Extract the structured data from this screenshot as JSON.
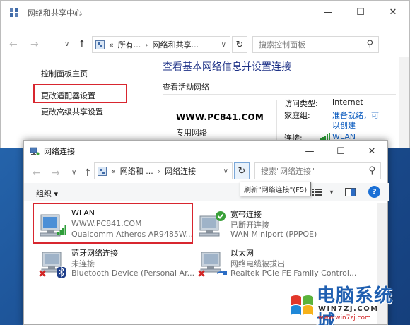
{
  "back_window": {
    "title": "网络和共享中心",
    "controls": {
      "minimize": "—",
      "maximize": "☐",
      "close": "✕"
    },
    "nav": {
      "back": "←",
      "forward": "→",
      "recent": "∨",
      "up": "↑"
    },
    "address": {
      "chevron": "«",
      "crumbs": [
        "所有...",
        "网络和共享..."
      ],
      "sep": "›",
      "dropdown": "∨",
      "refresh": "↻"
    },
    "search_placeholder": "搜索控制面板",
    "sidebar": {
      "home": "控制面板主页",
      "change_adapter": "更改适配器设置",
      "advanced_sharing": "更改高级共享设置"
    },
    "main": {
      "heading": "查看基本网络信息并设置连接",
      "active_networks": "查看活动网络",
      "network_name": "WWW.PC841.COM",
      "network_type": "专用网络",
      "access_type_label": "访问类型:",
      "access_type_value": "Internet",
      "homegroup_label": "家庭组:",
      "homegroup_value_1": "准备就绪，可",
      "homegroup_value_2": "以创建",
      "connection_label": "连接:",
      "connection_value": "WLAN"
    }
  },
  "front_window": {
    "title": "网络连接",
    "controls": {
      "minimize": "—",
      "maximize": "☐",
      "close": "✕"
    },
    "nav": {
      "back": "←",
      "forward": "→",
      "recent": "∨",
      "up": "↑"
    },
    "address": {
      "chevron": "«",
      "crumbs": [
        "网络和 ...",
        "网络连接"
      ],
      "sep": "›",
      "dropdown": "∨",
      "refresh": "↻"
    },
    "search_placeholder": "搜索\"网络连接\"",
    "tooltip": "刷新\"网络连接\"(F5)",
    "toolbar": {
      "organize": "组织 ▾",
      "view_toggle": "▾",
      "help": "?"
    },
    "connections": [
      {
        "name": "WLAN",
        "status": "WWW.PC841.COM",
        "device": "Qualcomm Atheros AR9485W..."
      },
      {
        "name": "宽带连接",
        "status": "已断开连接",
        "device": "WAN Miniport (PPPOE)"
      },
      {
        "name": "蓝牙网络连接",
        "status": "未连接",
        "device": "Bluetooth Device (Personal Ar..."
      },
      {
        "name": "以太网",
        "status": "网络电缆被拔出",
        "device": "Realtek PCIe FE Family Control..."
      }
    ]
  },
  "watermark": {
    "brand": "电脑系统城",
    "sub": "WIN7ZJ.COM",
    "url": "www.win7zj.com"
  },
  "colors": {
    "link_blue": "#1e3287",
    "highlight_red": "#d8262f",
    "value_blue": "#0a5bbf",
    "desktop": "#1b4f93"
  }
}
